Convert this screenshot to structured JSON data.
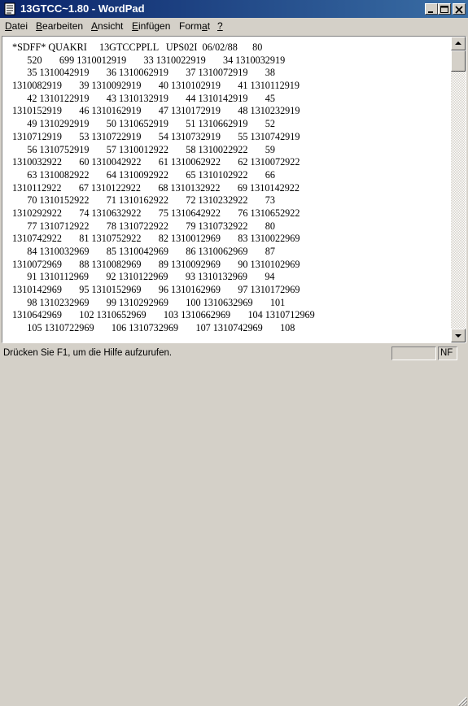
{
  "window": {
    "title": "13GTCC~1.80 - WordPad"
  },
  "icons": {
    "app": "wordpad-document-icon",
    "minimize": "minimize-icon",
    "maximize": "maximize-icon",
    "close": "close-icon",
    "scroll_up": "arrow-up-icon",
    "scroll_down": "arrow-down-icon",
    "grip": "resize-grip-icon"
  },
  "menu": {
    "items": [
      {
        "key": "D",
        "rest": "atei"
      },
      {
        "key": "B",
        "rest": "earbeiten"
      },
      {
        "key": "A",
        "rest": "nsicht"
      },
      {
        "key": "E",
        "rest": "infügen"
      },
      {
        "key": "Format",
        "rest": "",
        "plain": "Form",
        "u": "a",
        "tail": "t"
      },
      {
        "key": "?",
        "rest": ""
      }
    ],
    "labels": [
      "Datei",
      "Bearbeiten",
      "Ansicht",
      "Einfügen",
      "Format",
      "?"
    ]
  },
  "document": {
    "lines": [
      "*SDFF* QUAKRI     13GTCCPPLL   UPS02I  06/02/88      80",
      "      520       699 1310012919       33 1310022919       34 1310032919",
      "      35 1310042919       36 1310062919       37 1310072919       38",
      "1310082919       39 1310092919       40 1310102919       41 1310112919",
      "      42 1310122919       43 1310132919       44 1310142919       45",
      "1310152919       46 1310162919       47 1310172919       48 1310232919",
      "      49 1310292919       50 1310652919       51 1310662919       52",
      "1310712919       53 1310722919       54 1310732919       55 1310742919",
      "      56 1310752919       57 1310012922       58 1310022922       59",
      "1310032922       60 1310042922       61 1310062922       62 1310072922",
      "      63 1310082922       64 1310092922       65 1310102922       66",
      "1310112922       67 1310122922       68 1310132922       69 1310142922",
      "      70 1310152922       71 1310162922       72 1310232922       73",
      "1310292922       74 1310632922       75 1310642922       76 1310652922",
      "      77 1310712922       78 1310722922       79 1310732922       80",
      "1310742922       81 1310752922       82 1310012969       83 1310022969",
      "      84 1310032969       85 1310042969       86 1310062969       87",
      "1310072969       88 1310082969       89 1310092969       90 1310102969",
      "      91 1310112969       92 1310122969       93 1310132969       94",
      "1310142969       95 1310152969       96 1310162969       97 1310172969",
      "      98 1310232969       99 1310292969       100 1310632969       101",
      "1310642969       102 1310652969       103 1310662969       104 1310712969",
      "      105 1310722969       106 1310732969       107 1310742969       108"
    ]
  },
  "statusbar": {
    "help_text": "Drücken Sie F1, um die Hilfe aufzurufen.",
    "indicator": "NF"
  },
  "colors": {
    "titlebar_start": "#0a246a",
    "titlebar_end": "#3a6ea5",
    "chrome": "#d4d0c8",
    "document_bg": "#ffffff"
  }
}
